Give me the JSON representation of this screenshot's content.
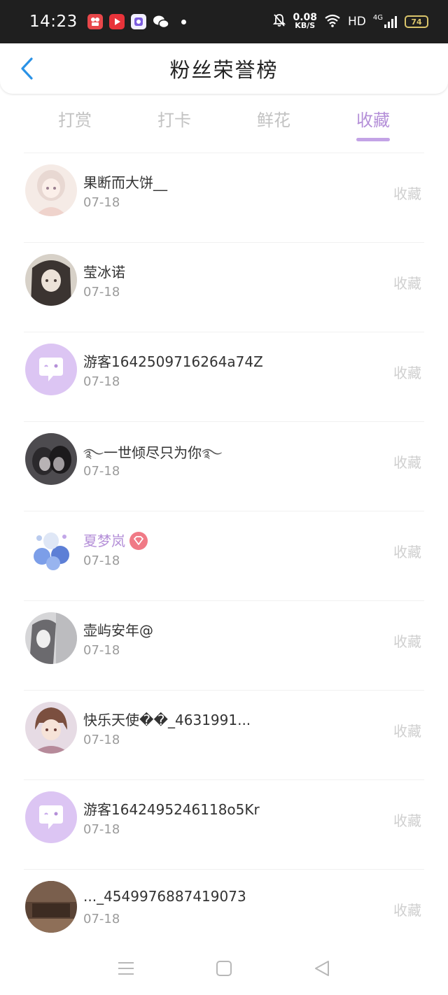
{
  "status_bar": {
    "time": "14:23",
    "net_speed_value": "0.08",
    "net_speed_unit": "KB/S",
    "hd_label": "HD",
    "network_type": "4G",
    "battery": "74"
  },
  "header": {
    "title": "粉丝荣誉榜"
  },
  "tabs": [
    {
      "label": "打赏",
      "active": false
    },
    {
      "label": "打卡",
      "active": false
    },
    {
      "label": "鲜花",
      "active": false
    },
    {
      "label": "收藏",
      "active": true
    }
  ],
  "colors": {
    "accent": "#b48fd8",
    "tab_inactive": "#c2c2c2",
    "action_text": "#cfcfcf",
    "vip_badge": "#f07a86",
    "default_avatar_bg": "#dcc5f3"
  },
  "rows": [
    {
      "name": "果断而大饼__",
      "date": "07-18",
      "action": "收藏",
      "avatar": "avatar-girl-light"
    },
    {
      "name": "莹冰诺",
      "date": "07-18",
      "action": "收藏",
      "avatar": "avatar-girl-dark-hair"
    },
    {
      "name": "游客1642509716264a74Z",
      "date": "07-18",
      "action": "收藏",
      "avatar": "default-chat-avatar"
    },
    {
      "name": "一世倾尽只为你",
      "date": "07-18",
      "action": "收藏",
      "avatar": "avatar-couple"
    },
    {
      "name": "夏梦岚",
      "date": "07-18",
      "action": "收藏",
      "avatar": "avatar-blue-flowers",
      "vip": true
    },
    {
      "name": "壶屿安年@",
      "date": "07-18",
      "action": "收藏",
      "avatar": "avatar-grey"
    },
    {
      "name": "快乐天使��_4631991...",
      "date": "07-18",
      "action": "收藏",
      "avatar": "avatar-boy"
    },
    {
      "name": "游客1642495246118o5Kr",
      "date": "07-18",
      "action": "收藏",
      "avatar": "default-chat-avatar"
    },
    {
      "name": "..._4549976887419073",
      "date": "07-18",
      "action": "收藏",
      "avatar": "avatar-brown"
    }
  ]
}
